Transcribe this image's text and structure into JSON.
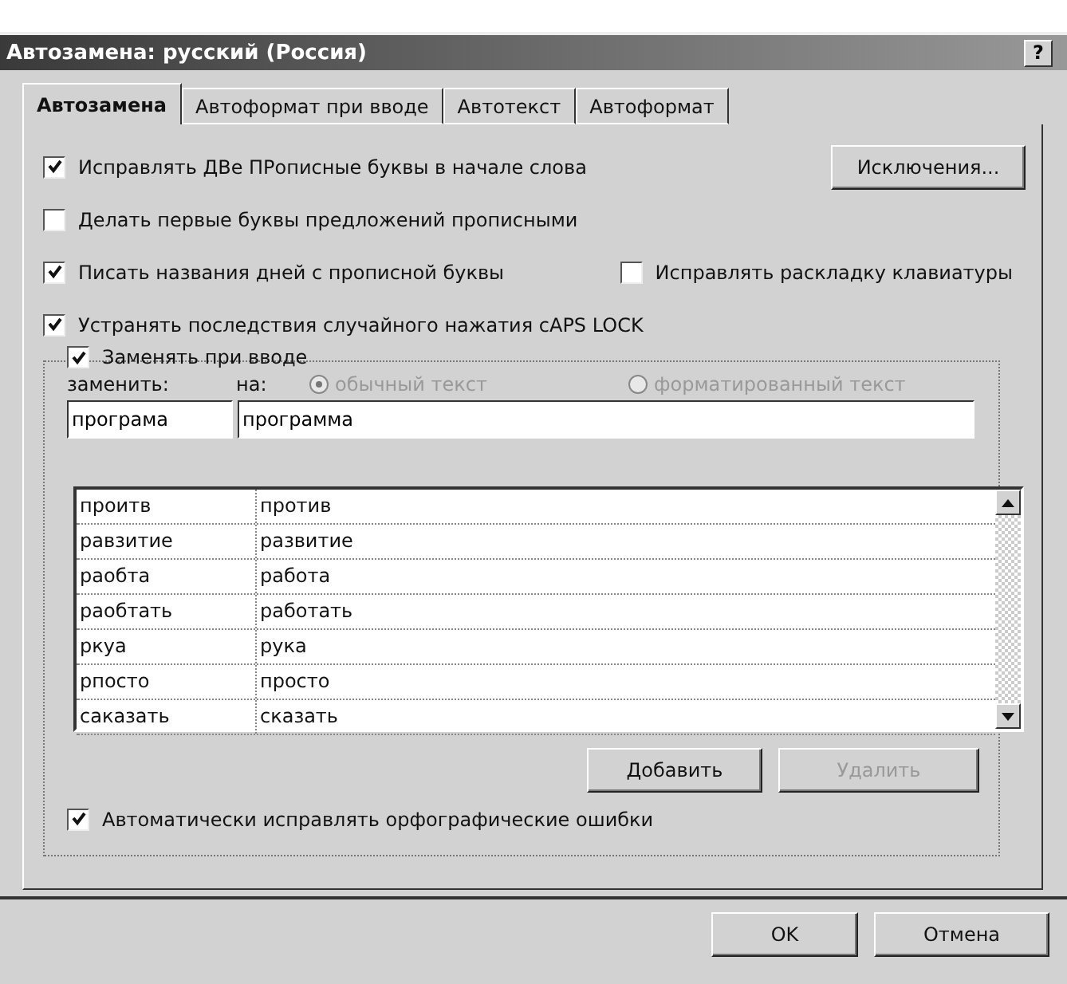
{
  "window": {
    "title": "Автозамена: русский (Россия)",
    "help": "?"
  },
  "tabs": [
    {
      "label": "Автозамена",
      "selected": true
    },
    {
      "label": "Автоформат при вводе",
      "selected": false
    },
    {
      "label": "Автотекст",
      "selected": false
    },
    {
      "label": "Автоформат",
      "selected": false
    }
  ],
  "options": [
    {
      "label": "Исправлять ДВе ПРописные буквы в начале слова",
      "checked": true
    },
    {
      "label": "Делать первые буквы предложений прописными",
      "checked": false
    },
    {
      "label": "Писать названия дней с прописной буквы",
      "checked": true
    },
    {
      "label": "Исправлять раскладку клавиатуры",
      "checked": false
    },
    {
      "label": "Устранять последствия случайного нажатия cAPS LOCK",
      "checked": true
    }
  ],
  "exceptions_button": "Исключения...",
  "replace_group": {
    "label": "Заменять при вводе",
    "checked": true,
    "replace_label": "заменить:",
    "with_label": "на:",
    "radios": [
      {
        "label": "обычный текст",
        "selected": true,
        "disabled": true
      },
      {
        "label": "форматированный текст",
        "selected": false,
        "disabled": true
      }
    ],
    "replace_value": "програма",
    "with_value": "программа",
    "rows": [
      [
        "проитв",
        "против"
      ],
      [
        "равзитие",
        "развитие"
      ],
      [
        "раобта",
        "работа"
      ],
      [
        "раобтать",
        "работать"
      ],
      [
        "ркуа",
        "рука"
      ],
      [
        "рпосто",
        "просто"
      ],
      [
        "саказать",
        "сказать"
      ]
    ],
    "buttons": [
      {
        "label": "Добавить",
        "disabled": false
      },
      {
        "label": "Удалить",
        "disabled": true
      }
    ],
    "spelling": {
      "label": "Автоматически исправлять орфографические ошибки",
      "checked": true
    }
  },
  "buttons": [
    "OK",
    "Отмена"
  ]
}
